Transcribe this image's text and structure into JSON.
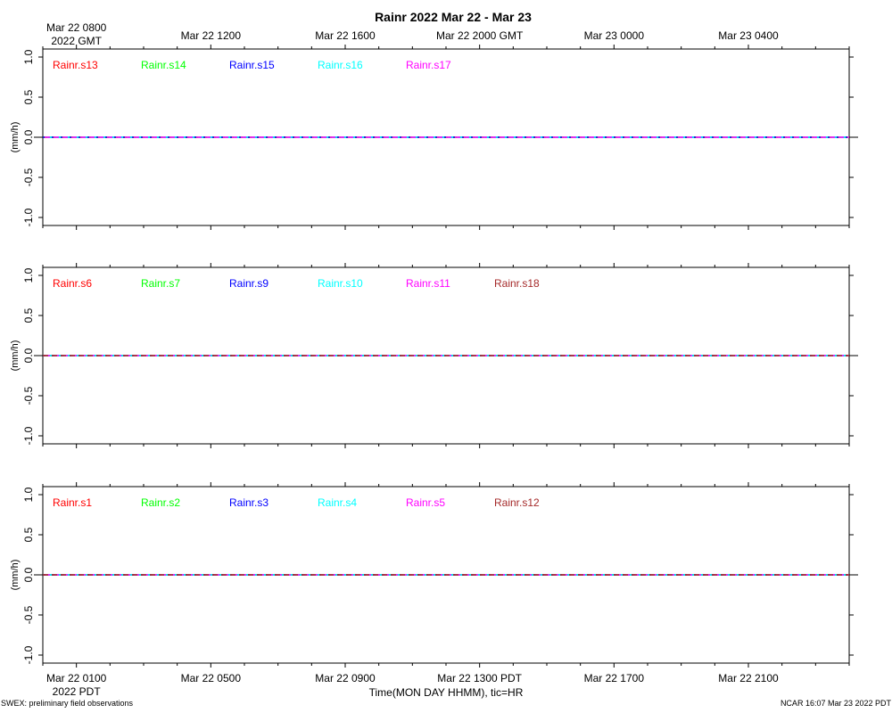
{
  "title": "Rainr 2022 Mar 22 - Mar 23",
  "top_axis": {
    "ticks": [
      {
        "label": "Mar 22 0800",
        "sublabel": "2022 GMT",
        "hour": 0
      },
      {
        "label": "Mar 22 1200",
        "sublabel": "",
        "hour": 4
      },
      {
        "label": "Mar 22 1600",
        "sublabel": "",
        "hour": 8
      },
      {
        "label": "Mar 22 2000 GMT",
        "sublabel": "",
        "hour": 12
      },
      {
        "label": "Mar 23 0000",
        "sublabel": "",
        "hour": 16
      },
      {
        "label": "Mar 23 0400",
        "sublabel": "",
        "hour": 20
      }
    ]
  },
  "bottom_axis": {
    "ticks": [
      {
        "label": "Mar 22 0100",
        "sublabel": "2022 PDT",
        "hour": 0
      },
      {
        "label": "Mar 22 0500",
        "sublabel": "",
        "hour": 4
      },
      {
        "label": "Mar 22 0900",
        "sublabel": "",
        "hour": 8
      },
      {
        "label": "Mar 22 1300 PDT",
        "sublabel": "",
        "hour": 12
      },
      {
        "label": "Mar 22 1700",
        "sublabel": "",
        "hour": 16
      },
      {
        "label": "Mar 22 2100",
        "sublabel": "",
        "hour": 20
      }
    ],
    "xlabel": "Time(MON DAY HHMM), tic=HR"
  },
  "footer": {
    "left": "SWEX: preliminary field observations",
    "right": "NCAR 16:07 Mar 23 2022 PDT"
  },
  "chart_data": [
    {
      "type": "line",
      "ylabel": "(mm/h)",
      "ylim": [
        -1.1,
        1.1
      ],
      "yticks": [
        "1.0",
        "0.5",
        "0.0",
        "-0.5",
        "-1.0"
      ],
      "xlim_hours": [
        -1,
        23
      ],
      "series": [
        {
          "name": "Rainr.s13",
          "color": "#ff0000",
          "x_hours": [
            -1,
            23
          ],
          "values": [
            0,
            0
          ]
        },
        {
          "name": "Rainr.s14",
          "color": "#00ff00",
          "x_hours": [
            -1,
            23
          ],
          "values": [
            0,
            0
          ]
        },
        {
          "name": "Rainr.s15",
          "color": "#0000ff",
          "x_hours": [
            -1,
            23
          ],
          "values": [
            0,
            0
          ]
        },
        {
          "name": "Rainr.s16",
          "color": "#00ffff",
          "x_hours": [
            -1,
            23
          ],
          "values": [
            0,
            0
          ]
        },
        {
          "name": "Rainr.s17",
          "color": "#ff00ff",
          "x_hours": [
            -1,
            23
          ],
          "values": [
            0,
            0
          ]
        }
      ]
    },
    {
      "type": "line",
      "ylabel": "(mm/h)",
      "ylim": [
        -1.1,
        1.1
      ],
      "yticks": [
        "1.0",
        "0.5",
        "0.0",
        "-0.5",
        "-1.0"
      ],
      "xlim_hours": [
        -1,
        23
      ],
      "series": [
        {
          "name": "Rainr.s6",
          "color": "#ff0000",
          "x_hours": [
            -1,
            23
          ],
          "values": [
            0,
            0
          ]
        },
        {
          "name": "Rainr.s7",
          "color": "#00ff00",
          "x_hours": [
            -1,
            23
          ],
          "values": [
            0,
            0
          ]
        },
        {
          "name": "Rainr.s9",
          "color": "#0000ff",
          "x_hours": [
            -1,
            23
          ],
          "values": [
            0,
            0
          ]
        },
        {
          "name": "Rainr.s10",
          "color": "#00ffff",
          "x_hours": [
            -1,
            23
          ],
          "values": [
            0,
            0
          ]
        },
        {
          "name": "Rainr.s11",
          "color": "#ff00ff",
          "x_hours": [
            -1,
            23
          ],
          "values": [
            0,
            0
          ]
        },
        {
          "name": "Rainr.s18",
          "color": "#a52a2a",
          "x_hours": [
            -1,
            23
          ],
          "values": [
            0,
            0
          ]
        }
      ]
    },
    {
      "type": "line",
      "ylabel": "(mm/h)",
      "ylim": [
        -1.1,
        1.1
      ],
      "yticks": [
        "1.0",
        "0.5",
        "0.0",
        "-0.5",
        "-1.0"
      ],
      "xlim_hours": [
        -1,
        23
      ],
      "series": [
        {
          "name": "Rainr.s1",
          "color": "#ff0000",
          "x_hours": [
            -1,
            23
          ],
          "values": [
            0,
            0
          ]
        },
        {
          "name": "Rainr.s2",
          "color": "#00ff00",
          "x_hours": [
            -1,
            23
          ],
          "values": [
            0,
            0
          ]
        },
        {
          "name": "Rainr.s3",
          "color": "#0000ff",
          "x_hours": [
            -1,
            23
          ],
          "values": [
            0,
            0
          ]
        },
        {
          "name": "Rainr.s4",
          "color": "#00ffff",
          "x_hours": [
            -1,
            23
          ],
          "values": [
            0,
            0
          ]
        },
        {
          "name": "Rainr.s5",
          "color": "#ff00ff",
          "x_hours": [
            -1,
            23
          ],
          "values": [
            0,
            0
          ]
        },
        {
          "name": "Rainr.s12",
          "color": "#a52a2a",
          "x_hours": [
            -1,
            23
          ],
          "values": [
            0,
            0
          ]
        }
      ]
    }
  ]
}
